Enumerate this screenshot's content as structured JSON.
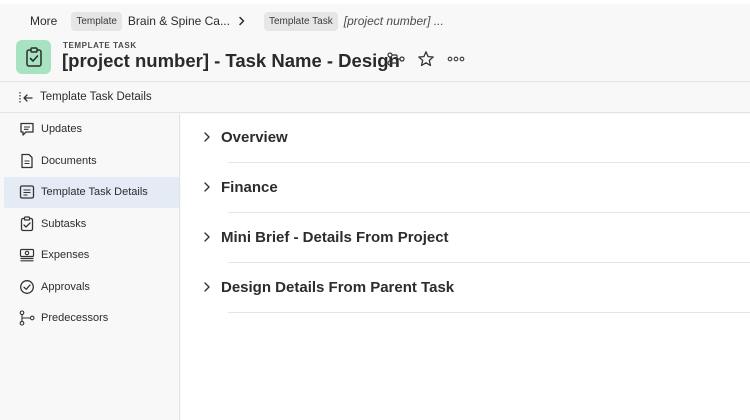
{
  "breadcrumb": {
    "more_label": "More",
    "items": [
      {
        "type_label": "Template",
        "name": "Brain & Spine Ca..."
      },
      {
        "type_label": "Template Task",
        "name": "[project number] ..."
      }
    ]
  },
  "header": {
    "subtitle": "TEMPLATE TASK",
    "title": "[project number] - Task Name - Design",
    "icon": "clipboard-check-icon",
    "icon_bg_color": "#a7e3c1",
    "actions": [
      "hierarchy-icon",
      "star-icon",
      "more-icon"
    ]
  },
  "subheader": {
    "title": "Template Task Details",
    "collapse_icon": "collapse-sidebar-icon"
  },
  "sidebar": {
    "active_color": "#e4ebf5",
    "items": [
      {
        "label": "Updates",
        "icon": "comment-icon",
        "active": false
      },
      {
        "label": "Documents",
        "icon": "document-icon",
        "active": false
      },
      {
        "label": "Template Task Details",
        "icon": "details-icon",
        "active": true
      },
      {
        "label": "Subtasks",
        "icon": "subtasks-icon",
        "active": false
      },
      {
        "label": "Expenses",
        "icon": "expenses-icon",
        "active": false
      },
      {
        "label": "Approvals",
        "icon": "approval-check-icon",
        "active": false
      },
      {
        "label": "Predecessors",
        "icon": "predecessors-icon",
        "active": false
      }
    ]
  },
  "main": {
    "sections": [
      {
        "title": "Overview",
        "expanded": false
      },
      {
        "title": "Finance",
        "expanded": false
      },
      {
        "title": "Mini Brief - Details From Project",
        "expanded": false
      },
      {
        "title": "Design Details From Parent Task",
        "expanded": false
      }
    ]
  }
}
